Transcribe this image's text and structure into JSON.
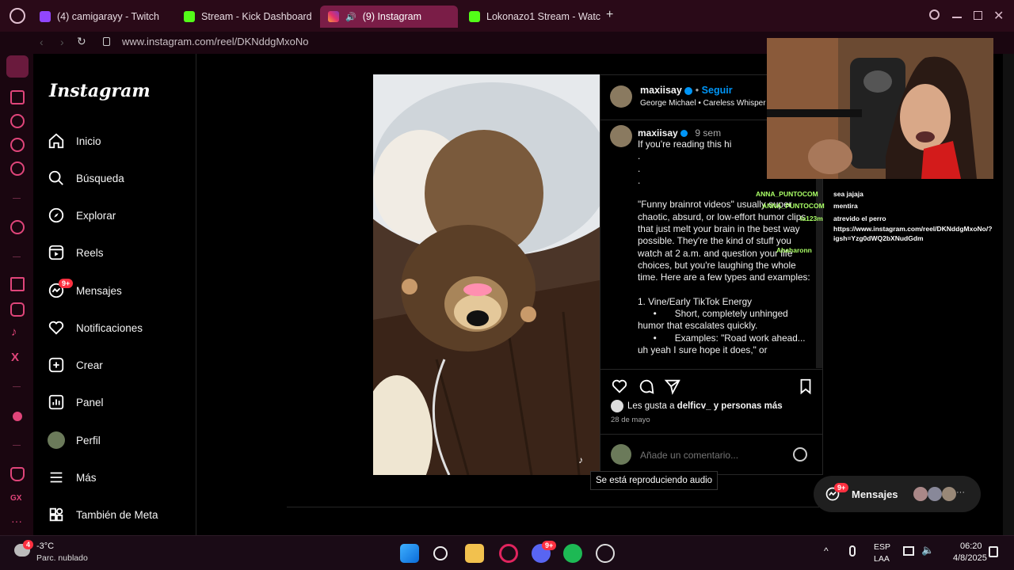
{
  "browser": {
    "tabs": [
      {
        "label": "(4) camigarayy - Twitch",
        "icon": "twitch-icon"
      },
      {
        "label": "Stream - Kick Dashboard",
        "icon": "kick-icon"
      },
      {
        "label": "(9) Instagram",
        "icon": "instagram-icon",
        "active": true
      },
      {
        "label": "Lokonazo1 Stream - Watc",
        "icon": "kick-icon"
      }
    ],
    "new_tab_label": "+",
    "url": "www.instagram.com/reel/DKNddgMxoNo"
  },
  "instagram": {
    "logo_text": "Instagram",
    "nav": [
      {
        "label": "Inicio",
        "icon": "home-icon"
      },
      {
        "label": "Búsqueda",
        "icon": "search-icon"
      },
      {
        "label": "Explorar",
        "icon": "compass-icon"
      },
      {
        "label": "Reels",
        "icon": "reels-icon"
      },
      {
        "label": "Mensajes",
        "icon": "messenger-icon",
        "badge": "9+"
      },
      {
        "label": "Notificaciones",
        "icon": "heart-icon"
      },
      {
        "label": "Crear",
        "icon": "plus-square-icon"
      },
      {
        "label": "Panel",
        "icon": "chart-icon"
      },
      {
        "label": "Perfil",
        "icon": "avatar-icon"
      },
      {
        "label": "Más",
        "icon": "menu-icon"
      },
      {
        "label": "También de Meta",
        "icon": "meta-icon"
      }
    ],
    "post": {
      "username": "maxiisay",
      "follow_label": "Seguir",
      "separator": "•",
      "audio": "George Michael • Careless Whisper",
      "caption_user": "maxiisay",
      "caption_time": "9 sem",
      "caption": "If you're reading this hi\n.\n.\n.\n\n\"Funny brainrot videos\" usually super chaotic, absurd, or low-effort humor clips that just melt your brain in the best way possible. They're the kind of stuff you watch at 2 a.m. and question your life choices, but you're laughing the whole time. Here are a few types and examples:\n\n1. Vine/Early TikTok Energy\n      •       Short, completely unhinged humor that escalates quickly.\n      •       Examples: \"Road work ahead... uh yeah I sure hope it does,\" or",
      "likes_prefix": "Les gusta a",
      "likes_user": "delficv_",
      "likes_suffix": "y personas más",
      "date": "28 de mayo",
      "comment_placeholder": "Añade un comentario...",
      "audio_tooltip": "Se está reproduciendo audio"
    },
    "messages_pill": {
      "label": "Mensajes",
      "badge": "9+",
      "more": "···"
    }
  },
  "stream_chat": [
    {
      "user": "ANNA_PUNTOCOM",
      "msg": "sea jajaja"
    },
    {
      "user": "ANNA_PUNTOCOM",
      "msg": "mentira"
    },
    {
      "user": "la123m",
      "msg": "atrevido el perro"
    },
    {
      "user": "",
      "msg": "https://www.instagram.com/reel/DKNddgMxoNo/?"
    },
    {
      "user": "",
      "msg": "igsh=Yzg0dWQ2bXNudGdm"
    },
    {
      "user": "Ahaharonn",
      "msg": ""
    }
  ],
  "taskbar": {
    "weather_temp": "-3°C",
    "weather_desc": "Parc. nublado",
    "weather_badge": "4",
    "lang_top": "ESP",
    "lang_bottom": "LAA",
    "time": "06:20",
    "date": "4/8/2025",
    "discord_badge": "9+"
  },
  "colors": {
    "accent_tab": "#7a1d47",
    "ig_blue": "#0095f6",
    "badge_red": "#ff3040"
  }
}
